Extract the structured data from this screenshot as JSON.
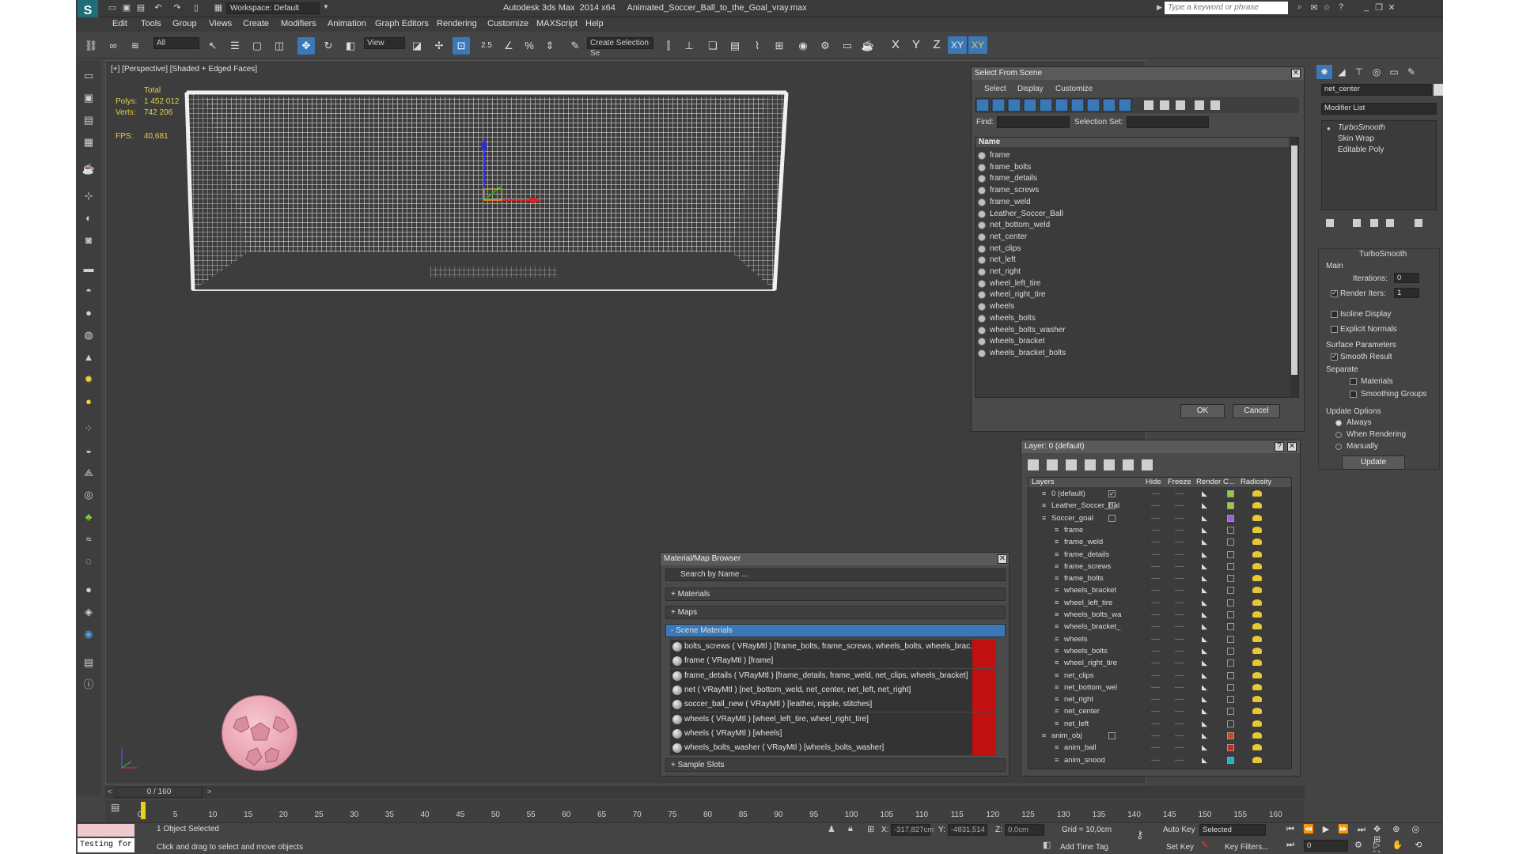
{
  "app": {
    "title": "Autodesk 3ds Max  2014 x64     Animated_Soccer_Ball_to_the_Goal_vray.max",
    "workspace": "Workspace: Default",
    "search_placeholder": "Type a keyword or phrase"
  },
  "menu": [
    "Edit",
    "Tools",
    "Group",
    "Views",
    "Create",
    "Modifiers",
    "Animation",
    "Graph Editors",
    "Rendering",
    "Customize",
    "MAXScript",
    "Help"
  ],
  "toolbar": {
    "filter": "All",
    "refcoord": "View",
    "selset": "Create Selection Se",
    "snap_label": "2.5",
    "axes": [
      "X",
      "Y",
      "Z",
      "XY",
      "XY"
    ]
  },
  "viewport": {
    "label": "[+] [Perspective] [Shaded + Edged Faces]",
    "stats": {
      "header": "Total",
      "polys_label": "Polys:",
      "polys": "1 452 012",
      "verts_label": "Verts:",
      "verts": "742 206",
      "fps_label": "FPS:",
      "fps": "40,681"
    }
  },
  "select_from_scene": {
    "title": "Select From Scene",
    "tabs": [
      "Select",
      "Display",
      "Customize"
    ],
    "find_label": "Find:",
    "selset_label": "Selection Set:",
    "column": "Name",
    "items": [
      "frame",
      "frame_bolts",
      "frame_details",
      "frame_screws",
      "frame_weld",
      "Leather_Soccer_Ball",
      "net_bottom_weld",
      "net_center",
      "net_clips",
      "net_left",
      "net_right",
      "wheel_left_tire",
      "wheel_right_tire",
      "wheels",
      "wheels_bolts",
      "wheels_bolts_washer",
      "wheels_bracket",
      "wheels_bracket_bolts"
    ],
    "ok": "OK",
    "cancel": "Cancel"
  },
  "layer_manager": {
    "title": "Layer: 0 (default)",
    "help": "?",
    "columns": [
      "Layers",
      "Hide",
      "Freeze",
      "Render",
      "C...",
      "Radiosity"
    ],
    "rows": [
      {
        "name": "0 (default)",
        "indent": 0,
        "check": "✓",
        "color": "#8fcf3a"
      },
      {
        "name": "Leather_Soccer_Bal",
        "indent": 0,
        "check": "",
        "color": "#9acd32"
      },
      {
        "name": "Soccer_goal",
        "indent": 0,
        "check": "",
        "color": "#9a5fd8"
      },
      {
        "name": "frame",
        "indent": 1,
        "color": ""
      },
      {
        "name": "frame_weld",
        "indent": 1,
        "color": ""
      },
      {
        "name": "frame_details",
        "indent": 1,
        "color": ""
      },
      {
        "name": "frame_screws",
        "indent": 1,
        "color": ""
      },
      {
        "name": "frame_bolts",
        "indent": 1,
        "color": ""
      },
      {
        "name": "wheels_bracket",
        "indent": 1,
        "color": ""
      },
      {
        "name": "wheel_left_tire",
        "indent": 1,
        "color": ""
      },
      {
        "name": "wheels_bolts_wa",
        "indent": 1,
        "color": ""
      },
      {
        "name": "wheels_bracket_",
        "indent": 1,
        "color": ""
      },
      {
        "name": "wheels",
        "indent": 1,
        "color": ""
      },
      {
        "name": "wheels_bolts",
        "indent": 1,
        "color": ""
      },
      {
        "name": "wheel_right_tire",
        "indent": 1,
        "color": ""
      },
      {
        "name": "net_clips",
        "indent": 1,
        "color": ""
      },
      {
        "name": "net_bottom_wel",
        "indent": 1,
        "color": ""
      },
      {
        "name": "net_right",
        "indent": 1,
        "color": ""
      },
      {
        "name": "net_center",
        "indent": 1,
        "color": ""
      },
      {
        "name": "net_left",
        "indent": 1,
        "color": ""
      },
      {
        "name": "anim_obj",
        "indent": 0,
        "check": "",
        "color": "#d04a10"
      },
      {
        "name": "anim_ball",
        "indent": 1,
        "color": "#d42020"
      },
      {
        "name": "anim_snood",
        "indent": 1,
        "color": "#20b0c8"
      }
    ]
  },
  "material_browser": {
    "title": "Material/Map Browser",
    "search": "Search by Name ...",
    "cat_materials": "+ Materials",
    "cat_maps": "+ Maps",
    "cat_scene": "- Scene Materials",
    "cat_samples": "+ Sample Slots",
    "items": [
      "bolts_screws ( VRayMtl ) [frame_bolts, frame_screws, wheels_bolts, wheels_brac...",
      "frame ( VRayMtl ) [frame]",
      "frame_details ( VRayMtl ) [frame_details, frame_weld, net_clips, wheels_bracket]",
      "net ( VRayMtl ) [net_bottom_weld, net_center, net_left, net_right]",
      "soccer_ball_new ( VRayMtl ) [leather, nipple, stitches]",
      "wheels ( VRayMtl ) [wheel_left_tire, wheel_right_tire]",
      "wheels ( VRayMtl ) [wheels]",
      "wheels_bolts_washer ( VRayMtl ) [wheels_bolts_washer]"
    ]
  },
  "command_panel": {
    "object_name": "net_center",
    "modifier_list": "Modifier List",
    "stack": [
      "TurboSmooth",
      "Skin Wrap",
      "Editable Poly"
    ],
    "turbosmooth": {
      "title": "TurboSmooth",
      "main": "Main",
      "iterations_label": "Iterations:",
      "iterations": "0",
      "render_iters_label": "Render Iters:",
      "render_iters": "1",
      "isoline": "Isoline Display",
      "explicit": "Explicit Normals",
      "surface": "Surface Parameters",
      "smooth_result": "Smooth Result",
      "separate": "Separate",
      "materials": "Materials",
      "smoothing_groups": "Smoothing Groups",
      "update_options": "Update Options",
      "always": "Always",
      "when_rendering": "When Rendering",
      "manually": "Manually",
      "update": "Update"
    }
  },
  "timeline": {
    "frame": "0 / 160",
    "ticks": [
      "0",
      "5",
      "10",
      "15",
      "20",
      "25",
      "30",
      "35",
      "40",
      "45",
      "50",
      "55",
      "60",
      "65",
      "70",
      "75",
      "80",
      "85",
      "90",
      "95",
      "100",
      "105",
      "110",
      "115",
      "120",
      "125",
      "130",
      "135",
      "140",
      "145",
      "150",
      "155",
      "160"
    ]
  },
  "status": {
    "script": "Testing for :",
    "selected": "1 Object Selected",
    "prompt": "Click and drag to select and move objects",
    "x_label": "X:",
    "x": "-317,827cm",
    "y_label": "Y:",
    "y": "-4831,514",
    "z_label": "Z:",
    "z": "0,0cm",
    "grid": "Grid = 10,0cm",
    "add_time_tag": "Add Time Tag",
    "auto_key": "Auto Key",
    "set_key": "Set Key",
    "selected_drop": "Selected",
    "key_filters": "Key Filters...",
    "frame_field": "0"
  }
}
